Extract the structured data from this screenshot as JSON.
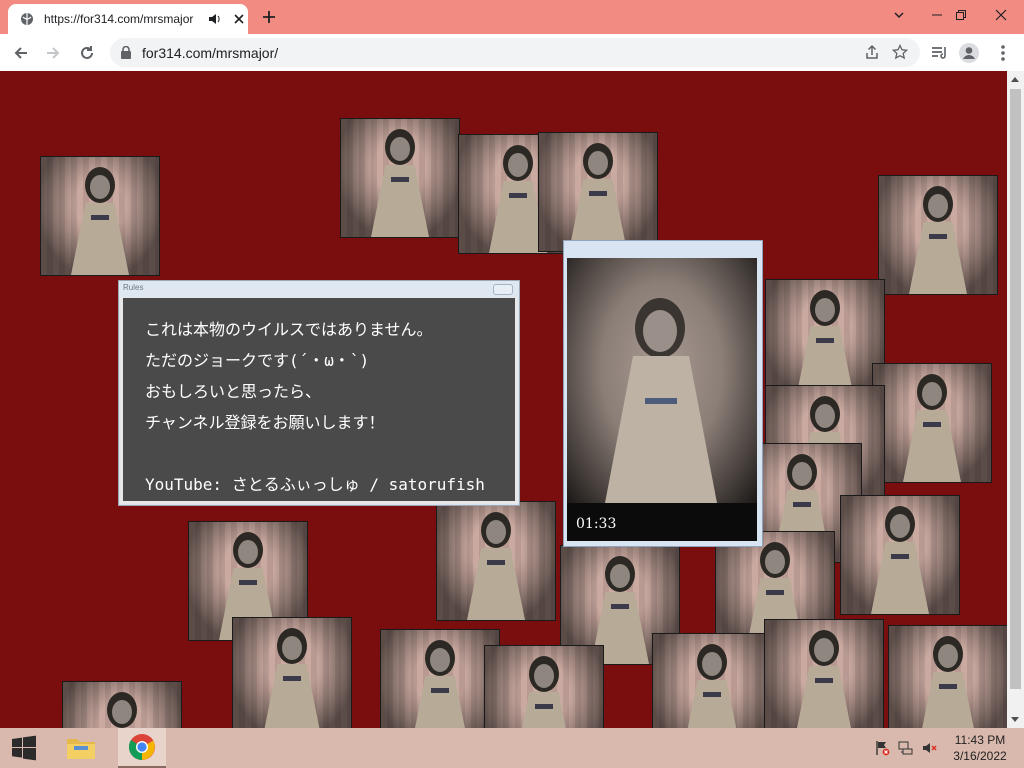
{
  "browser": {
    "tab_title": "https://for314.com/mrsmajor",
    "url": "for314.com/mrsmajor/"
  },
  "popup": {
    "title": "Rules",
    "lines": [
      "これは本物のウイルスではありません。",
      "ただのジョークです(´・ω・`)",
      "おもしろいと思ったら、",
      "チャンネル登録をお願いします！",
      "",
      "YouTube:  さとるふぃっしゅ / satorufish"
    ]
  },
  "video": {
    "time": "01:33"
  },
  "taskbar": {
    "time": "11:43 PM",
    "date": "3/16/2022"
  },
  "colors": {
    "page_background": "#7a0d0d",
    "titlebar": "#f28b82",
    "taskbar": "#d9b9ad"
  },
  "icons": [
    "favicon-globe-icon",
    "speaker-icon",
    "close-icon",
    "plus-icon",
    "minimize-icon",
    "maximize-icon",
    "back-icon",
    "forward-icon",
    "reload-icon",
    "lock-icon",
    "share-icon",
    "star-icon",
    "media-queue-icon",
    "profile-icon",
    "menu-icon",
    "windows-start-icon",
    "file-explorer-icon",
    "chrome-icon",
    "flag-icon",
    "network-icon",
    "volume-muted-icon"
  ]
}
